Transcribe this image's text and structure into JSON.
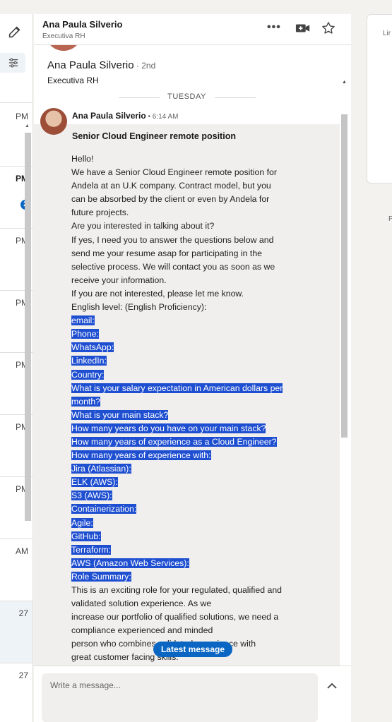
{
  "left_list": {
    "unread_count": "2",
    "items": [
      {
        "time": "PM",
        "bold": false
      },
      {
        "time": "PM",
        "bold": true
      },
      {
        "time": "PM",
        "bold": false
      },
      {
        "time": "PM",
        "bold": false
      },
      {
        "time": "PM",
        "bold": false
      },
      {
        "time": "PM",
        "bold": false
      },
      {
        "time": "PM",
        "bold": false
      },
      {
        "time": "AM",
        "bold": false
      },
      {
        "time": "27",
        "bold": false
      },
      {
        "time": "27",
        "bold": false
      }
    ]
  },
  "header": {
    "name": "Ana Paula Silverio",
    "subtitle": "Executiva RH",
    "more_label": "•••"
  },
  "profile": {
    "name": "Ana Paula Silverio",
    "degree": " · 2nd",
    "title": "Executiva RH"
  },
  "day_separator": "TUESDAY",
  "message": {
    "sender": "Ana Paula Silverio",
    "time": " • 6:14 AM",
    "subject": "Senior Cloud Engineer remote position",
    "lines": [
      {
        "text": "Hello!",
        "hl": false
      },
      {
        "text": "We have a Senior Cloud Engineer remote position for",
        "hl": false
      },
      {
        "text": "Andela at an U.K company. Contract model, but you",
        "hl": false
      },
      {
        "text": "can be absorbed by the client or even by Andela for",
        "hl": false
      },
      {
        "text": "future projects.",
        "hl": false
      },
      {
        "text": "Are you interested in talking about it?",
        "hl": false
      },
      {
        "text": "If yes, I need you to answer the questions below and",
        "hl": false
      },
      {
        "text": "send me your resume asap for participating in the",
        "hl": false
      },
      {
        "text": "selective process. We will contact you as soon as we",
        "hl": false
      },
      {
        "text": "receive your information.",
        "hl": false
      },
      {
        "text": "If you are not interested, please let me know.",
        "hl": false
      },
      {
        "text": "English level: (English Proficiency):",
        "hl": false
      },
      {
        "text": "email:",
        "hl": true
      },
      {
        "text": "Phone:",
        "hl": true
      },
      {
        "text": "WhatsApp:",
        "hl": true
      },
      {
        "text": "LinkedIn:",
        "hl": true
      },
      {
        "text": "Country:",
        "hl": true
      },
      {
        "text": "What is your salary expectation in American dollars per",
        "hl": true
      },
      {
        "text": "month?",
        "hl": true
      },
      {
        "text": "What is your main stack?",
        "hl": true
      },
      {
        "text": "How many years do you have on your main stack?",
        "hl": true
      },
      {
        "text": "How many years of experience as a Cloud Engineer?",
        "hl": true
      },
      {
        "text": "How many years of experience with:",
        "hl": true
      },
      {
        "text": "Jira (Atlassian):",
        "hl": true
      },
      {
        "text": "ELK (AWS):",
        "hl": true
      },
      {
        "text": "S3 (AWS):",
        "hl": true
      },
      {
        "text": "Containerization:",
        "hl": true
      },
      {
        "text": "Agile:",
        "hl": true
      },
      {
        "text": "GitHub:",
        "hl": true
      },
      {
        "text": "Terraform:",
        "hl": true
      },
      {
        "text": "AWS (Amazon Web Services):",
        "hl": true
      },
      {
        "text": "Role Summary:",
        "hl": true
      },
      {
        "text": "This is an exciting role for your regulated, qualified and",
        "hl": false
      },
      {
        "text": "validated solution experience. As we",
        "hl": false
      },
      {
        "text": "increase our portfolio of qualified solutions, we need a",
        "hl": false
      },
      {
        "text": "compliance experienced and minded",
        "hl": false
      },
      {
        "text": "person who combines validated experience with",
        "hl": false
      },
      {
        "text": "great customer facing skills.",
        "hl": false
      }
    ]
  },
  "latest_message_label": "Latest message",
  "composer": {
    "placeholder": "Write a message..."
  },
  "right_pane": {
    "text_1": "Lir",
    "text_2": "P"
  },
  "colors": {
    "accent": "#0a66c2",
    "selection": "#1f4fd1",
    "bubble": "#f0efed"
  }
}
